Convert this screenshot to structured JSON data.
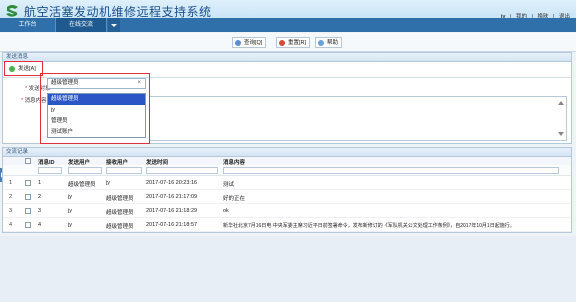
{
  "app": {
    "title": "航空活塞发动机维修远程支持系统"
  },
  "userbar": {
    "user": "jy",
    "sep1": "|",
    "home": "我的",
    "sep2": "|",
    "switch": "换肤",
    "sep3": "|",
    "logout": "退出"
  },
  "tabs": [
    {
      "label": "工作台"
    },
    {
      "label": "在线交流"
    }
  ],
  "toolbar": {
    "query": "查询[Q]",
    "reset": "重置[R]",
    "help": "帮助"
  },
  "send_panel": {
    "title": "发送消息",
    "send_button": "发送[A]",
    "target_label": "发送对象",
    "content_label": "消息内容"
  },
  "dropdown": {
    "selected": "超级管理员",
    "clear_symbol": "×",
    "options": [
      "超级管理员",
      "jy",
      "管理员",
      "测试账户"
    ]
  },
  "records": {
    "title": "交流记录",
    "columns": [
      "消息ID",
      "发送用户",
      "接收用户",
      "发送时间",
      "消息内容"
    ],
    "rows": [
      {
        "num": "1",
        "id": "1",
        "sender": "超级管理员",
        "receiver": "jy",
        "time": "2017-07-16 20:23:16",
        "content": "测试"
      },
      {
        "num": "2",
        "id": "2",
        "sender": "jy",
        "receiver": "超级管理员",
        "time": "2017-07-16 21:17:09",
        "content": "好的正在"
      },
      {
        "num": "3",
        "id": "3",
        "sender": "jy",
        "receiver": "超级管理员",
        "time": "2017-07-16 21:18:29",
        "content": "ok"
      },
      {
        "num": "4",
        "id": "4",
        "sender": "jy",
        "receiver": "超级管理员",
        "time": "2017-07-16 21:18:57",
        "content": "新华社北京7月16日电 中央军委主席习近平日前签署命令，发布新修订的《军队机关公文处理工作条例》，自2017年10月1日起施行。"
      }
    ]
  },
  "colors": {
    "header_bar": "#2f6faa",
    "highlight": "#e0303a",
    "selected_option": "#2a56c6"
  }
}
